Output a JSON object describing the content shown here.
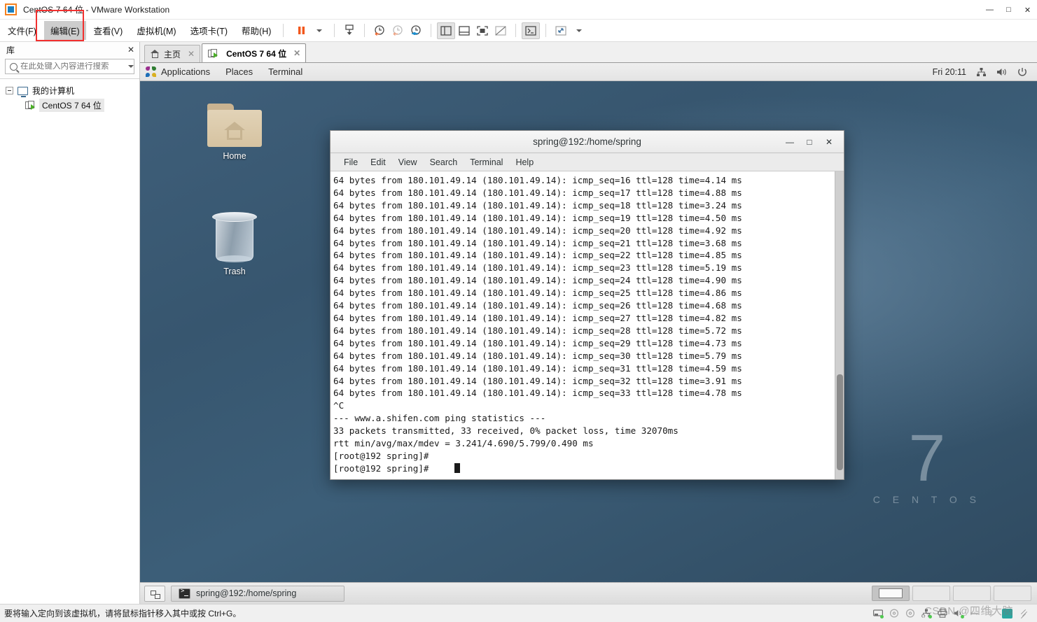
{
  "window": {
    "title": "CentOS 7 64 位 - VMware Workstation",
    "controls": {
      "minimize": "—",
      "maximize": "□",
      "close": "✕"
    }
  },
  "menubar": {
    "items": [
      {
        "label": "文件(F)",
        "selected": false
      },
      {
        "label": "编辑(E)",
        "selected": true
      },
      {
        "label": "查看(V)",
        "selected": false
      },
      {
        "label": "虚拟机(M)",
        "selected": false
      },
      {
        "label": "选项卡(T)",
        "selected": false
      },
      {
        "label": "帮助(H)",
        "selected": false
      }
    ],
    "toolbar": [
      {
        "name": "suspend-icon"
      },
      {
        "name": "power-dropdown-caret-icon"
      },
      {
        "name": "snapshot-take-icon"
      },
      {
        "name": "snapshot-revert-icon"
      },
      {
        "name": "snapshot-back-icon"
      },
      {
        "name": "snapshot-manager-icon"
      },
      {
        "name": "show-library-icon"
      },
      {
        "name": "show-thumbnail-bar-icon"
      },
      {
        "name": "full-screen-icon"
      },
      {
        "name": "unity-mode-icon"
      },
      {
        "name": "console-view-icon"
      },
      {
        "name": "stretch-guest-icon"
      },
      {
        "name": "stretch-dropdown-caret-icon"
      }
    ]
  },
  "library": {
    "title": "库",
    "close_label": "✕",
    "search": {
      "placeholder": "在此处键入内容进行搜索",
      "value": ""
    },
    "tree": [
      {
        "label": "我的计算机",
        "level": 1
      },
      {
        "label": "CentOS 7 64 位",
        "level": 2
      }
    ]
  },
  "tabs": [
    {
      "label": "主页",
      "active": false,
      "close": "✕"
    },
    {
      "label": "CentOS 7 64 位",
      "active": true,
      "close": "✕"
    }
  ],
  "gnome_panel": {
    "menus": [
      "Applications",
      "Places",
      "Terminal"
    ],
    "clock": "Fri 20:11",
    "tray": [
      "network-icon",
      "volume-icon",
      "power-icon"
    ]
  },
  "desktop": {
    "icons": [
      {
        "label": "Home",
        "name": "desktop-icon-home"
      },
      {
        "label": "Trash",
        "name": "desktop-icon-trash"
      }
    ],
    "brand": {
      "number": "7",
      "word": "C E N T O S"
    }
  },
  "terminal": {
    "title": "spring@192:/home/spring",
    "buttons": {
      "minimize": "—",
      "maximize": "□",
      "close": "✕"
    },
    "menu": [
      "File",
      "Edit",
      "View",
      "Search",
      "Terminal",
      "Help"
    ],
    "output": "64 bytes from 180.101.49.14 (180.101.49.14): icmp_seq=16 ttl=128 time=4.14 ms\n64 bytes from 180.101.49.14 (180.101.49.14): icmp_seq=17 ttl=128 time=4.88 ms\n64 bytes from 180.101.49.14 (180.101.49.14): icmp_seq=18 ttl=128 time=3.24 ms\n64 bytes from 180.101.49.14 (180.101.49.14): icmp_seq=19 ttl=128 time=4.50 ms\n64 bytes from 180.101.49.14 (180.101.49.14): icmp_seq=20 ttl=128 time=4.92 ms\n64 bytes from 180.101.49.14 (180.101.49.14): icmp_seq=21 ttl=128 time=3.68 ms\n64 bytes from 180.101.49.14 (180.101.49.14): icmp_seq=22 ttl=128 time=4.85 ms\n64 bytes from 180.101.49.14 (180.101.49.14): icmp_seq=23 ttl=128 time=5.19 ms\n64 bytes from 180.101.49.14 (180.101.49.14): icmp_seq=24 ttl=128 time=4.90 ms\n64 bytes from 180.101.49.14 (180.101.49.14): icmp_seq=25 ttl=128 time=4.86 ms\n64 bytes from 180.101.49.14 (180.101.49.14): icmp_seq=26 ttl=128 time=4.68 ms\n64 bytes from 180.101.49.14 (180.101.49.14): icmp_seq=27 ttl=128 time=4.82 ms\n64 bytes from 180.101.49.14 (180.101.49.14): icmp_seq=28 ttl=128 time=5.72 ms\n64 bytes from 180.101.49.14 (180.101.49.14): icmp_seq=29 ttl=128 time=4.73 ms\n64 bytes from 180.101.49.14 (180.101.49.14): icmp_seq=30 ttl=128 time=5.79 ms\n64 bytes from 180.101.49.14 (180.101.49.14): icmp_seq=31 ttl=128 time=4.59 ms\n64 bytes from 180.101.49.14 (180.101.49.14): icmp_seq=32 ttl=128 time=3.91 ms\n64 bytes from 180.101.49.14 (180.101.49.14): icmp_seq=33 ttl=128 time=4.78 ms\n^C\n--- www.a.shifen.com ping statistics ---\n33 packets transmitted, 33 received, 0% packet loss, time 32070ms\nrtt min/avg/max/mdev = 3.241/4.690/5.799/0.490 ms\n[root@192 spring]#\n[root@192 spring]# "
  },
  "vm_taskbar": {
    "window_button": "spring@192:/home/spring",
    "workspaces": [
      {
        "active": true
      },
      {
        "active": false
      },
      {
        "active": false
      },
      {
        "active": false
      }
    ]
  },
  "statusbar": {
    "message": "要将输入定向到该虚拟机，请将鼠标指针移入其中或按 Ctrl+G。",
    "watermark": "CSDN @四维大脑",
    "devices": [
      "harddisk-icon",
      "cdrom-icon",
      "cdrom2-icon",
      "network-adapter-icon",
      "printer-icon",
      "sound-icon",
      "usb-icon",
      "bluetooth-icon"
    ]
  },
  "colors": {
    "accent_orange": "#f58220",
    "accent_blue": "#1a7fc1",
    "highlight_red": "#f2302f",
    "desktop_blue": "#3f5f7a"
  }
}
